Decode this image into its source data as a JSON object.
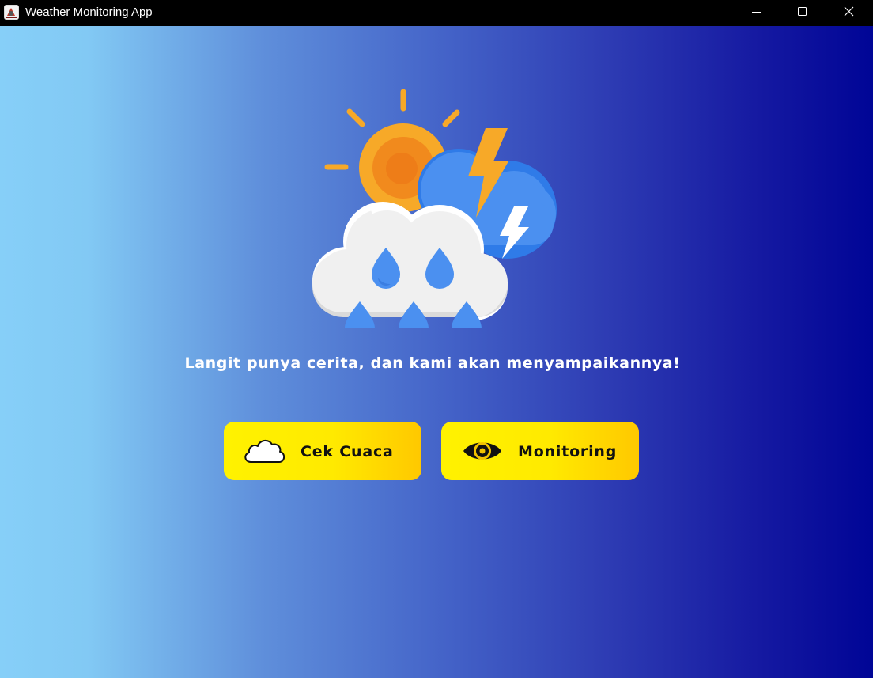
{
  "window": {
    "title": "Weather Monitoring App",
    "controls": [
      "minimize",
      "maximize",
      "close"
    ]
  },
  "hero": {
    "icon": "sun-cloud-rain-lightning-icon"
  },
  "tagline": "Langit punya cerita, dan kami akan menyampaikannya!",
  "buttons": {
    "cek_cuaca": {
      "label": "Cek Cuaca",
      "icon": "cloud-icon"
    },
    "monitoring": {
      "label": "Monitoring",
      "icon": "eye-icon"
    }
  },
  "colors": {
    "gradient_left": "#86cff8",
    "gradient_right": "#000596",
    "button_yellow": "#fff200",
    "button_orange": "#ffc800",
    "titlebar": "#000000"
  }
}
